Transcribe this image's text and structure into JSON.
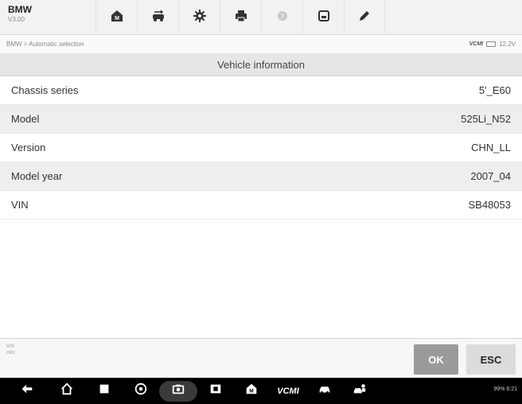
{
  "app": {
    "name": "BMW",
    "version": "V3.00"
  },
  "toolbar": {
    "buttons": [
      {
        "icon": "home-icon"
      },
      {
        "icon": "vehicle-swap-icon"
      },
      {
        "icon": "settings-icon"
      },
      {
        "icon": "print-icon"
      },
      {
        "icon": "help-icon"
      },
      {
        "icon": "save-icon"
      },
      {
        "icon": "edit-icon"
      }
    ]
  },
  "breadcrumb": {
    "path": "BMW > Automatic selection",
    "voltage": "12.2V",
    "vcmi_label": "VCMI"
  },
  "panel": {
    "title": "Vehicle information"
  },
  "rows": [
    {
      "label": "Chassis series",
      "value": "5'_E60"
    },
    {
      "label": "Model",
      "value": "525Li_N52"
    },
    {
      "label": "Version",
      "value": "CHN_LL"
    },
    {
      "label": "Model year",
      "value": "2007_04"
    },
    {
      "label": "VIN",
      "value": "SB48053"
    }
  ],
  "info": {
    "line1": "VIN",
    "line2": "Info:"
  },
  "buttons": {
    "ok": "OK",
    "esc": "ESC"
  },
  "navbar": {
    "vcmi": "VCMI",
    "status": "99% 6:21"
  },
  "colors": {
    "ok_bg": "#9a9a9a",
    "esc_bg": "#dcdcdc",
    "navbar_bg": "#000000"
  }
}
